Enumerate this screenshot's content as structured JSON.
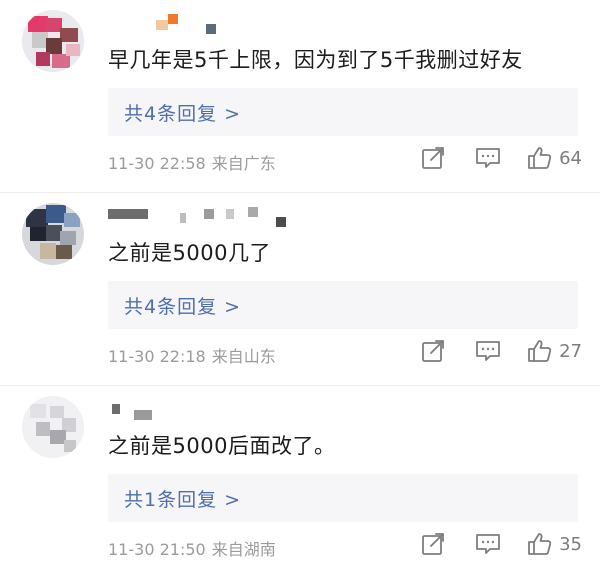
{
  "comments": [
    {
      "text": "早几年是5千上限，因为到了5千我删过好友",
      "reply_label": "共4条回复 >",
      "time": "11-30 22:58",
      "location": "来自广东",
      "likes": "64"
    },
    {
      "text": "之前是5000几了",
      "reply_label": "共4条回复 >",
      "time": "11-30 22:18",
      "location": "来自山东",
      "likes": "27"
    },
    {
      "text": "之前是5000后面改了。",
      "reply_label": "共1条回复 >",
      "time": "11-30 21:50",
      "location": "来自湖南",
      "likes": "35"
    }
  ],
  "icons": {
    "share": "share-icon",
    "reply": "comment-icon",
    "like": "thumbs-up-icon"
  }
}
